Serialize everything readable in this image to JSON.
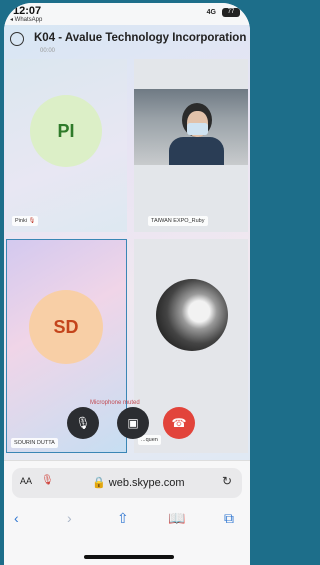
{
  "status": {
    "time": "12:07",
    "back_app": "◂ WhatsApp",
    "signal": "4G",
    "battery": "77"
  },
  "meeting": {
    "title": "K04 - Avalue Technology Incorporation",
    "subtitle": "00:00"
  },
  "participants": [
    {
      "initials": "PI",
      "name": "Pinki",
      "muted": true
    },
    {
      "name": "TAIWAN EXPO_Ruby",
      "video": true
    },
    {
      "initials": "SD",
      "name": "SOURIN DUTTA",
      "muted": true,
      "active_speaker": true
    },
    {
      "name": "...quen",
      "photo": "cat"
    }
  ],
  "controls": {
    "muted_notice": "Microphone muted",
    "mic": "mic-off-icon",
    "camera": "camera-off-icon",
    "end": "end-call-icon"
  },
  "browser": {
    "aa": "AA",
    "url": "web.skype.com"
  },
  "colors": {
    "accent": "#3a86b5",
    "end_call": "#e2443b"
  }
}
